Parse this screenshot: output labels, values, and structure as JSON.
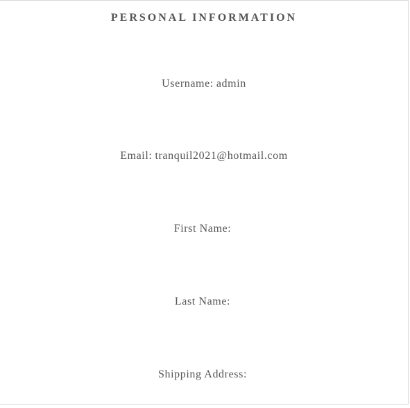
{
  "section": {
    "title": "PERSONAL INFORMATION"
  },
  "fields": {
    "username": {
      "label": "Username:",
      "value": "admin"
    },
    "email": {
      "label": "Email:",
      "value": "tranquil2021@hotmail.com"
    },
    "first_name": {
      "label": "First Name:",
      "value": ""
    },
    "last_name": {
      "label": "Last Name:",
      "value": ""
    },
    "shipping_address": {
      "label": "Shipping Address:",
      "value": ""
    }
  }
}
